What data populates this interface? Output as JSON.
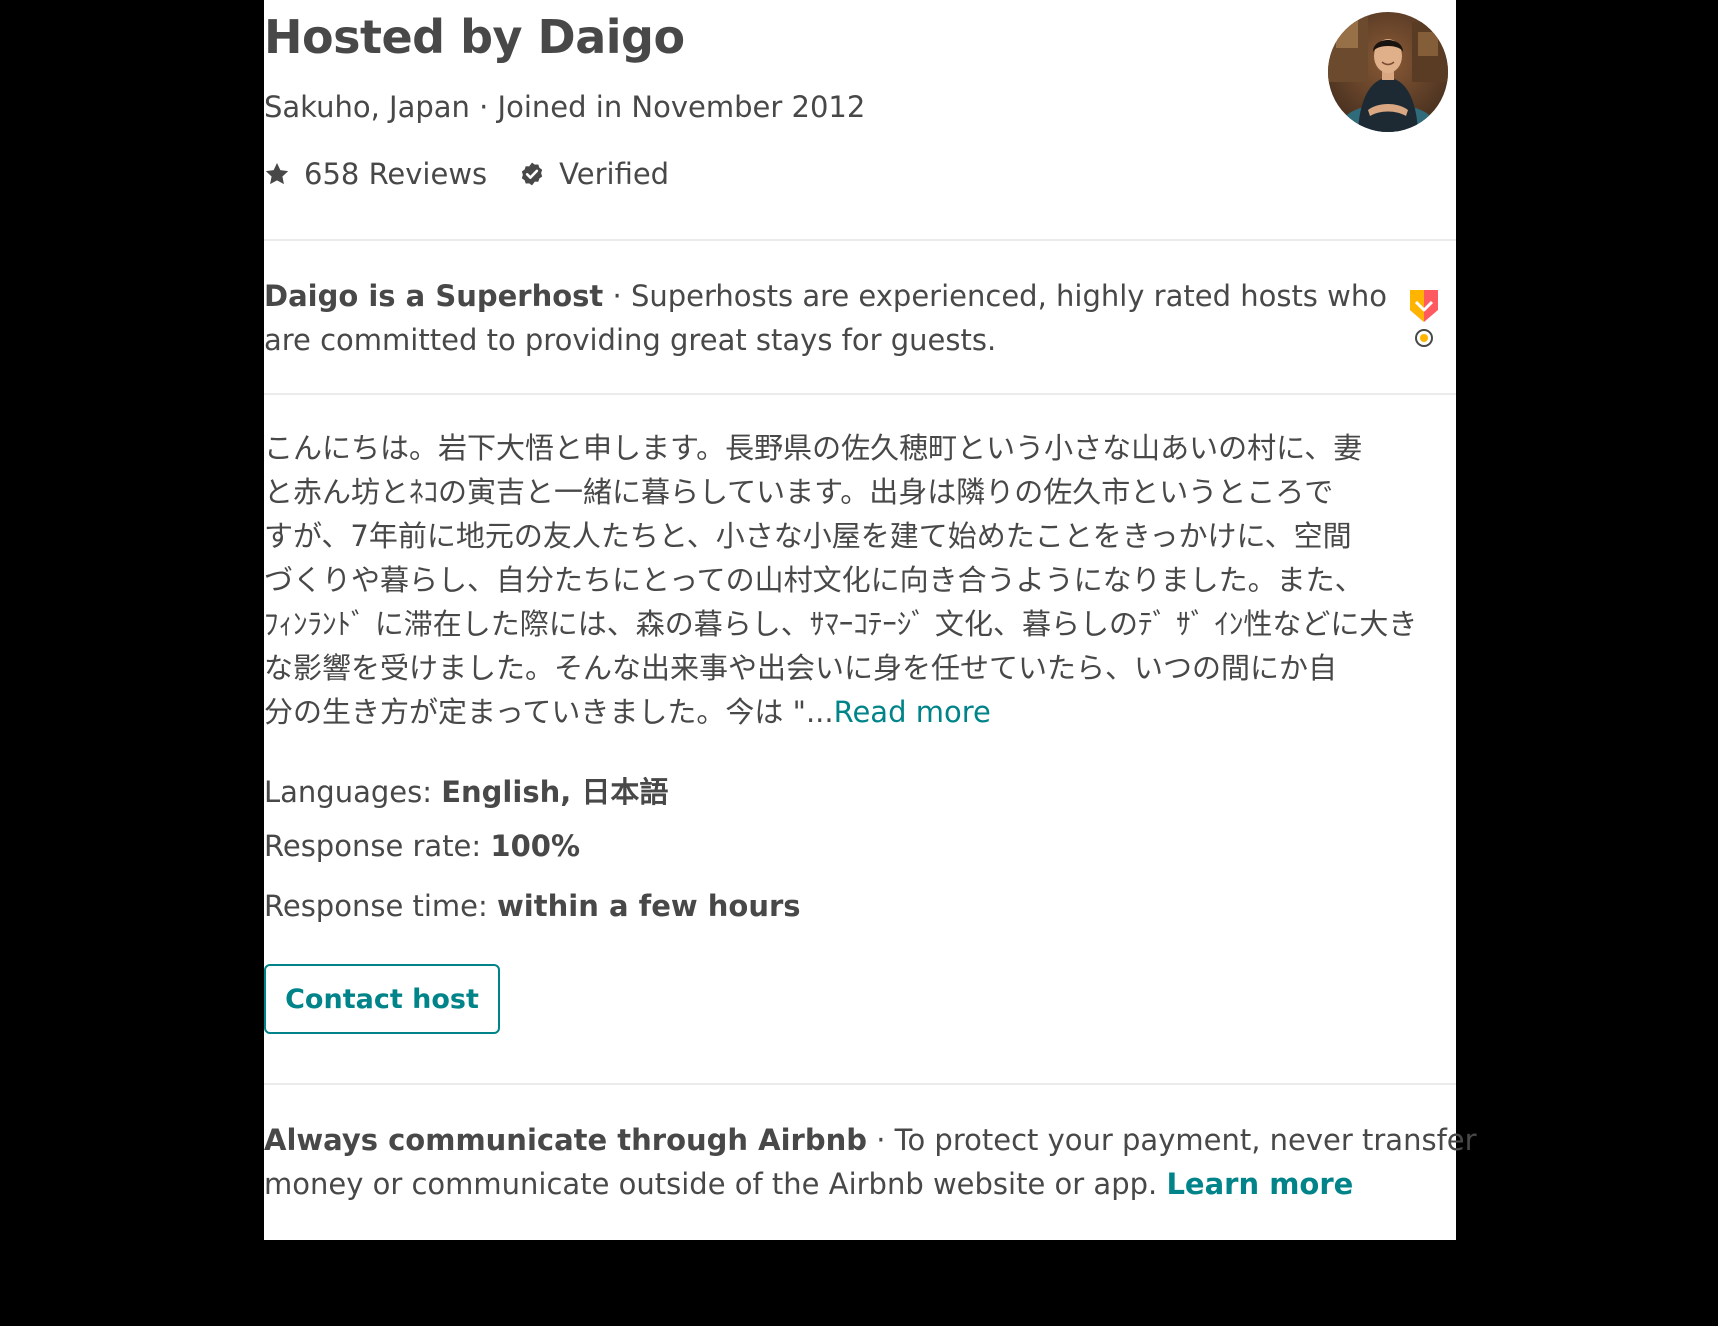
{
  "host": {
    "title": "Hosted by Daigo",
    "location_joined": "Sakuho, Japan · Joined in November 2012",
    "reviews": "658 Reviews",
    "verified": "Verified",
    "icons": {
      "reviews": "star-icon",
      "verified": "verified-shield-icon",
      "avatar": "host-avatar-photo"
    }
  },
  "superhost": {
    "heading": "Daigo is a Superhost",
    "separator": " · ",
    "description_line1": "Superhosts are experienced, highly rated hosts who",
    "description_line2": "are committed to providing great stays for guests.",
    "icon": "superhost-medal-icon"
  },
  "bio": {
    "lines": [
      "こんにちは。岩下大悟と申します。長野県の佐久穂町という小さな山あいの村に、妻",
      "と赤ん坊とﾈｺの寅吉と一緒に暮らしています。出身は隣りの佐久市というところで",
      "すが、7年前に地元の友人たちと、小さな小屋を建て始めたことをきっかけに、空間",
      "づくりや暮らし、自分たちにとっての山村文化に向き合うようになりました。また、",
      "ﾌｨﾝﾗﾝﾄﾞ に滞在した際には、森の暮らし、ｻﾏｰｺﾃｰｼﾞ 文化、暮らしのﾃﾞ ｻﾞ ｲﾝ性などに大き",
      "な影響を受けました。そんな出来事や出会いに身を任せていたら、いつの間にか自",
      "分の生き方が定まっていきました。今は \"..."
    ],
    "read_more": "Read more"
  },
  "details": {
    "languages_label": "Languages: ",
    "languages_value": "English, 日本語",
    "response_rate_label": "Response rate: ",
    "response_rate_value": "100%",
    "response_time_label": "Response time: ",
    "response_time_value": "within a few hours"
  },
  "contact_button": "Contact host",
  "notice": {
    "heading": "Always communicate through Airbnb",
    "separator": " · ",
    "line1": "To protect your payment, never transfer",
    "line2": "money or communicate outside of the Airbnb website or app. ",
    "learn_more": "Learn more"
  },
  "colors": {
    "text": "#484848",
    "accent": "#008489",
    "divider": "#ebebeb",
    "superhost_pink": "#ff5a5f",
    "superhost_orange": "#ffb400"
  }
}
